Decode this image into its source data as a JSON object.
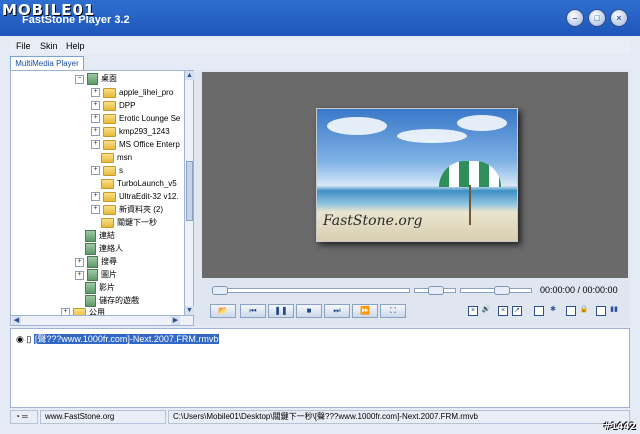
{
  "watermark": "MOBILE01",
  "window": {
    "title": "FastStone Player 3.2",
    "stamp": "#1442"
  },
  "menu": {
    "file": "File",
    "skin": "Skin",
    "help": "Help"
  },
  "tabs": {
    "active": "MultiMedia Player"
  },
  "tree": {
    "root": "桌面",
    "folders": [
      "apple_lihei_pro",
      "DPP",
      "Erotic Lounge Se",
      "kmp293_1243",
      "MS Office Enterp",
      "msn",
      "s",
      "TurboLaunch_v5",
      "UltraEdit-32 v12.",
      "新資料夾 (2)",
      "關鍵下一秒"
    ],
    "special": [
      "連結",
      "連絡人",
      "搜尋",
      "圖片",
      "影片",
      "儲存的遊戲",
      "公用"
    ]
  },
  "player": {
    "time": "00:00:00 / 00:00:00",
    "thumbnail_logo": "FastStone.org",
    "seek_progress": 0.0,
    "volume_level": 0.6
  },
  "playlist": {
    "items": [
      "[聲???www.1000fr.com]-Next.2007.FRM.rmvb"
    ]
  },
  "status": {
    "site": "www.FastStone.org",
    "path": "C:\\Users\\Mobile01\\Desktop\\關鍵下一秒\\[聲???www.1000fr.com]-Next.2007.FRM.rmvb"
  },
  "colors": {
    "titlebar": "#1e56b8",
    "selection": "#3168c6",
    "accent": "#2c4f9a"
  }
}
